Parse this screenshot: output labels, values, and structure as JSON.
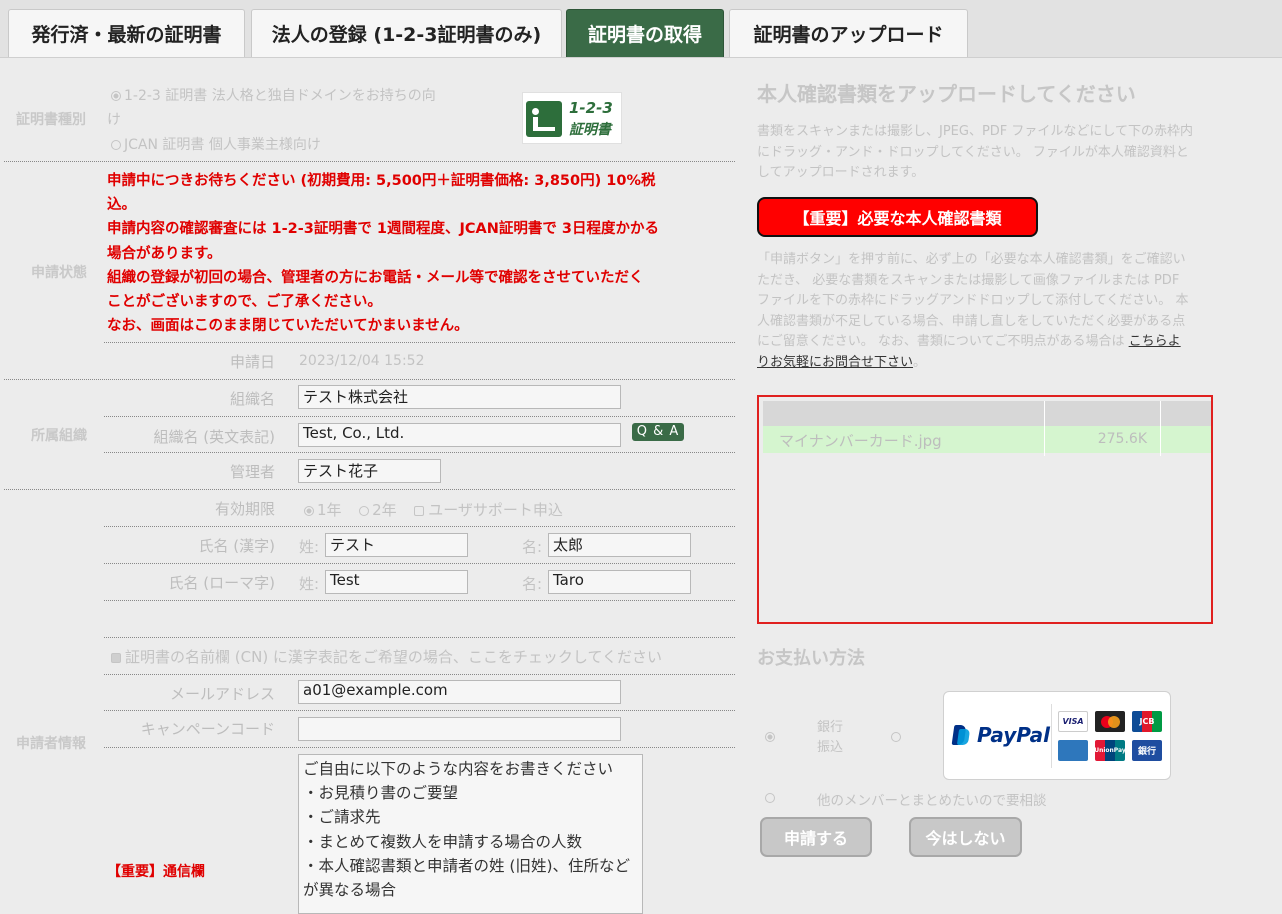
{
  "tabs": [
    {
      "label": "発行済・最新の証明書"
    },
    {
      "label": "法人の登録 (1-2-3証明書のみ)"
    },
    {
      "label": "証明書の取得"
    },
    {
      "label": "証明書のアップロード"
    }
  ],
  "cert_type": {
    "section_label": "証明書種別",
    "option1_line1": "1-2-3 証明書 法人格と独自ドメインをお持ちの向",
    "option1_line2": "け",
    "option2": "JCAN 証明書 個人事業主様向け",
    "logo_text": "1-2-3",
    "logo_sub": "証明書"
  },
  "status": {
    "section_label": "申請状態",
    "lines": [
      "申請中につきお待ちください (初期費用: 5,500円＋証明書価格: 3,850円) 10%税",
      "込。",
      "申請内容の確認審査には 1-2-3証明書で 1週間程度、JCAN証明書で 3日程度かかる",
      "場合があります。",
      "組織の登録が初回の場合、管理者の方にお電話・メール等で確認をさせていただく",
      "ことがございますので、ご了承ください。",
      "なお、画面はこのまま閉じていただいてかまいません。"
    ],
    "date_label": "申請日",
    "date_value": "2023/12/04 15:52"
  },
  "org": {
    "section_label": "所属組織",
    "name_label": "組織名",
    "name_value": "テスト株式会社",
    "name_en_label": "組織名 (英文表記)",
    "name_en_value": "Test, Co., Ltd.",
    "qa_label": "Q & A",
    "admin_label": "管理者",
    "admin_value": "テスト花子"
  },
  "applicant": {
    "section_label": "申請者情報",
    "validity_label": "有効期限",
    "validity_opt1": "1年",
    "validity_opt2": "2年",
    "support_label": "ユーザサポート申込",
    "kanji_label": "氏名 (漢字)",
    "roman_label": "氏名 (ローマ字)",
    "sei_label": "姓:",
    "mei_label": "名:",
    "sei_kanji": "テスト",
    "mei_kanji": "太郎",
    "sei_roman": "Test",
    "mei_roman": "Taro",
    "cn_check_label": "証明書の名前欄 (CN) に漢字表記をご希望の場合、ここをチェックしてください",
    "email_label": "メールアドレス",
    "email_value": "a01@example.com",
    "campaign_label": "キャンペーンコード",
    "campaign_value": "",
    "comm_label": "【重要】通信欄",
    "comm_lines": [
      "ご自由に以下のような内容をお書きください",
      "・お見積り書のご要望",
      "・ご請求先",
      "・まとめて複数人を申請する場合の人数",
      "・本人確認書類と申請者の姓 (旧姓)、住所など",
      "が異なる場合"
    ]
  },
  "upload": {
    "title": "本人確認書類をアップロードしてください",
    "desc_lines": [
      "書類をスキャンまたは撮影し、JPEG、PDF ファイルなどにして下の赤枠内",
      "にドラッグ・アンド・ドロップしてください。 ファイルが本人確認資料と",
      "してアップロードされます。"
    ],
    "important_button": "【重要】必要な本人確認書類",
    "notice_lines": [
      "「申請ボタン」を押す前に、必ず上の「必要な本人確認書類」をご確認い",
      "ただき、 必要な書類をスキャンまたは撮影して画像ファイルまたは PDF",
      "ファイルを下の赤枠にドラッグアンドドロップして添付してください。 本",
      "人確認書類が不足している場合、申請し直しをしていただく必要がある点",
      "にご留意ください。 なお、書類についてご不明点がある場合は "
    ],
    "link_part1": "こちらよ",
    "link_part2": "りお気軽にお問合せ下さい",
    "link_end": "。",
    "file_name": "マイナンバーカード.jpg",
    "file_size": "275.6K"
  },
  "payment": {
    "title": "お支払い方法",
    "bank_line1": "銀行",
    "bank_line2": "振込",
    "paypal": "PayPal",
    "cards": [
      "VISA",
      "",
      "JCB",
      "",
      "UnionPay",
      "銀行"
    ],
    "group_label": "他のメンバーとまとめたいので要相談",
    "apply_button": "申請する",
    "later_button": "今はしない"
  }
}
